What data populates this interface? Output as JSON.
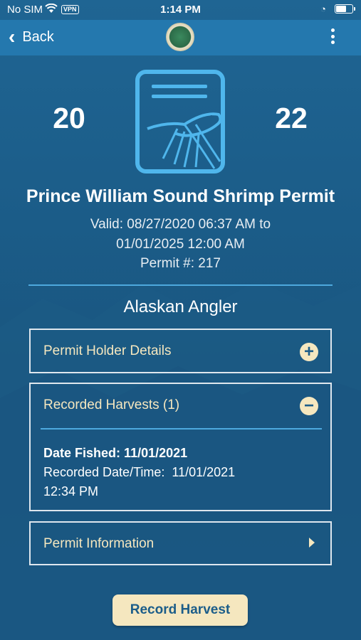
{
  "status_bar": {
    "carrier": "No SIM",
    "vpn": "VPN",
    "time": "1:14 PM"
  },
  "nav": {
    "back_label": "Back"
  },
  "permit": {
    "year_left": "20",
    "year_right": "22",
    "title": "Prince William Sound Shrimp Permit",
    "valid_line1": "Valid: 08/27/2020 06:37 AM to",
    "valid_line2": "01/01/2025 12:00 AM",
    "permit_number": "Permit #: 217",
    "holder": "Alaskan Angler"
  },
  "sections": {
    "holder_details": "Permit Holder Details",
    "recorded_harvests": "Recorded Harvests (1)",
    "permit_information": "Permit Information"
  },
  "harvest": {
    "date_fished_label": "Date Fished:",
    "date_fished_value": "11/01/2021",
    "recorded_label": "Recorded Date/Time:",
    "recorded_value": "11/01/2021",
    "recorded_time": "12:34 PM"
  },
  "actions": {
    "record_harvest": "Record Harvest"
  },
  "colors": {
    "background": "#1e5f8b",
    "nav": "#2478ae",
    "accent": "#f5e7bf",
    "divider": "#4ea9de"
  }
}
